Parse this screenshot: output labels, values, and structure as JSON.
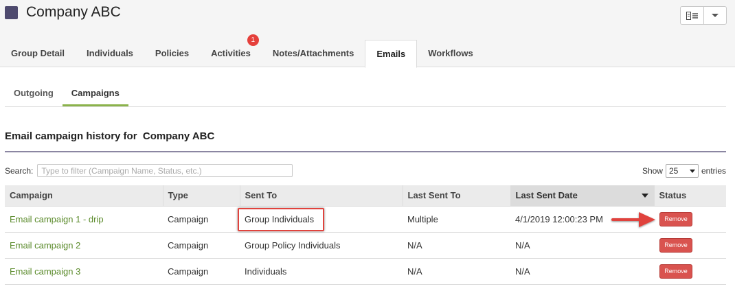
{
  "header": {
    "title": "Company ABC",
    "logo_color": "#4e4a6e",
    "view_icon": "document-list-icon"
  },
  "main_tabs": [
    {
      "label": "Group Detail"
    },
    {
      "label": "Individuals"
    },
    {
      "label": "Policies"
    },
    {
      "label": "Activities",
      "badge": "1"
    },
    {
      "label": "Notes/Attachments"
    },
    {
      "label": "Emails",
      "active": true
    },
    {
      "label": "Workflows"
    }
  ],
  "sub_tabs": [
    {
      "label": "Outgoing"
    },
    {
      "label": "Campaigns",
      "active": true
    }
  ],
  "section": {
    "title": "Email campaign history for  Company ABC"
  },
  "search": {
    "label": "Search:",
    "placeholder": "Type to filter (Campaign Name, Status, etc.)",
    "value": ""
  },
  "page_size": {
    "show_label": "Show",
    "value": "25",
    "entries_label": "entries"
  },
  "table": {
    "headers": [
      "Campaign",
      "Type",
      "Sent To",
      "Last Sent To",
      "Last Sent Date",
      "Status"
    ],
    "sorted_column": "Last Sent Date",
    "rows": [
      {
        "campaign": "Email campaign 1 - drip",
        "type": "Campaign",
        "sent_to": "Group Individuals",
        "last_sent_to": "Multiple",
        "last_sent_date": "4/1/2019 12:00:23 PM",
        "status_button": "Remove"
      },
      {
        "campaign": "Email campaign 2",
        "type": "Campaign",
        "sent_to": "Group Policy Individuals",
        "last_sent_to": "N/A",
        "last_sent_date": "N/A",
        "status_button": "Remove"
      },
      {
        "campaign": "Email campaign 3",
        "type": "Campaign",
        "sent_to": "Individuals",
        "last_sent_to": "N/A",
        "last_sent_date": "N/A",
        "status_button": "Remove"
      }
    ]
  },
  "colors": {
    "accent_green": "#8bb34b",
    "link_green": "#5a8a2a",
    "danger_red": "#d9534f",
    "annotation_red": "#e0433d"
  }
}
